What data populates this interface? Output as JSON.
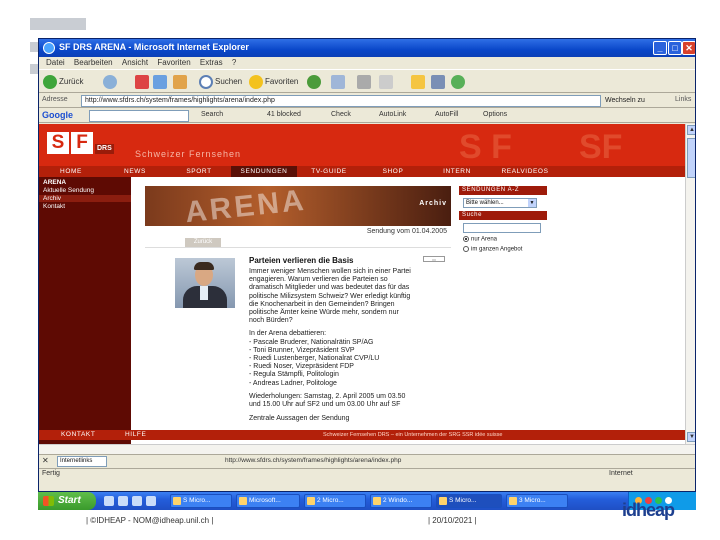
{
  "window": {
    "title": "SF DRS ARENA - Microsoft Internet Explorer",
    "controls": [
      "_",
      "□",
      "✕"
    ]
  },
  "menu": [
    "Datei",
    "Bearbeiten",
    "Ansicht",
    "Favoriten",
    "Extras",
    "?"
  ],
  "toolbar": {
    "back": "Zurück",
    "search": "Suchen",
    "favorites": "Favoriten"
  },
  "address": {
    "label": "Adresse",
    "url": "http://www.sfdrs.ch/system/frames/highlights/arena/index.php",
    "go": "Wechseln zu",
    "links": "Links"
  },
  "google": {
    "logo": "Google",
    "items": [
      "Search",
      "41 blocked",
      "Check",
      "AutoLink",
      "AutoFill",
      "Options"
    ]
  },
  "site": {
    "logo_s": "S",
    "logo_f": "F",
    "logo_drs": "DRS",
    "slogan": "Schweizer Fernsehen",
    "nav": [
      "HOME",
      "NEWS",
      "SPORT",
      "SENDUNGEN",
      "TV-GUIDE",
      "SHOP",
      "INTERN",
      "REALVIDEOS"
    ],
    "left_nav": [
      "ARENA",
      "Aktuelle Sendung",
      "Archiv",
      "Kontakt"
    ],
    "banner_title": "ARENA",
    "banner_archiv": "Archiv",
    "sendung_date": "Sendung vom 01.04.2005",
    "zurueck": "Zurück",
    "article": {
      "title": "Parteien verlieren die Basis",
      "paragraph1": [
        "Immer weniger Menschen wollen sich in einer Partei",
        "engagieren. Warum verlieren die Parteien so",
        "dramatisch Mitglieder und was bedeutet das für das",
        "politische Milizsystem Schweiz? Wer erledigt künftig",
        "die Knochenarbeit in den Gemeinden? Bringen",
        "politische Ämter keine Würde mehr, sondern nur",
        "noch Bürden?"
      ],
      "paragraph2_intro": "In der Arena debattieren:",
      "guests": [
        "- Pascale Bruderer, Nationalrätin SP/AG",
        "- Toni Brunner, Vizepräsident SVP",
        "- Ruedi Lustenberger, Nationalrat CVP/LU",
        "- Ruedi Noser, Vizepräsident FDP",
        "- Regula Stämpfli, Politologin",
        "- Andreas Ladner, Politologe"
      ],
      "repeat": [
        "Wiederholungen: Samstag, 2. April 2005 um 03.50",
        "und 15.00 Uhr auf SF2 und um 03.00 Uhr auf SF"
      ],
      "summary_heading": "Zentrale Aussagen der Sendung"
    },
    "abc": {
      "header": "SENDUNGEN A-Z",
      "select_label": "Bitte wählen..."
    },
    "search": {
      "header": "Suche",
      "option1": "nur Arena",
      "option2": "im ganzen Angebot"
    },
    "footer": {
      "items": [
        "KONTAKT",
        "HILFE"
      ],
      "note": "Schweizer Fernsehen DRS – ein Unternehmen der SRG SSR idée suisse"
    }
  },
  "links_bar": {
    "select": "Internetlinks",
    "info": "http://www.sfdrs.ch/system/frames/highlights/arena/index.php"
  },
  "status": {
    "text": "Fertig",
    "zone": "Internet"
  },
  "taskbar": {
    "start": "Start",
    "tasks": [
      "S Micro...",
      "Microsoft...",
      "2 Micro...",
      "2 Windo...",
      "S Micro...",
      "3 Micro..."
    ]
  },
  "slide_footer": {
    "left": "| ©IDHEAP - NOM@idheap.unil.ch |",
    "date": "| 20/10/2021 |",
    "logo": "idheap"
  },
  "colors": {
    "sf_red": "#d72910",
    "sf_dark": "#5e0a03",
    "xp_blue": "#245edb"
  }
}
